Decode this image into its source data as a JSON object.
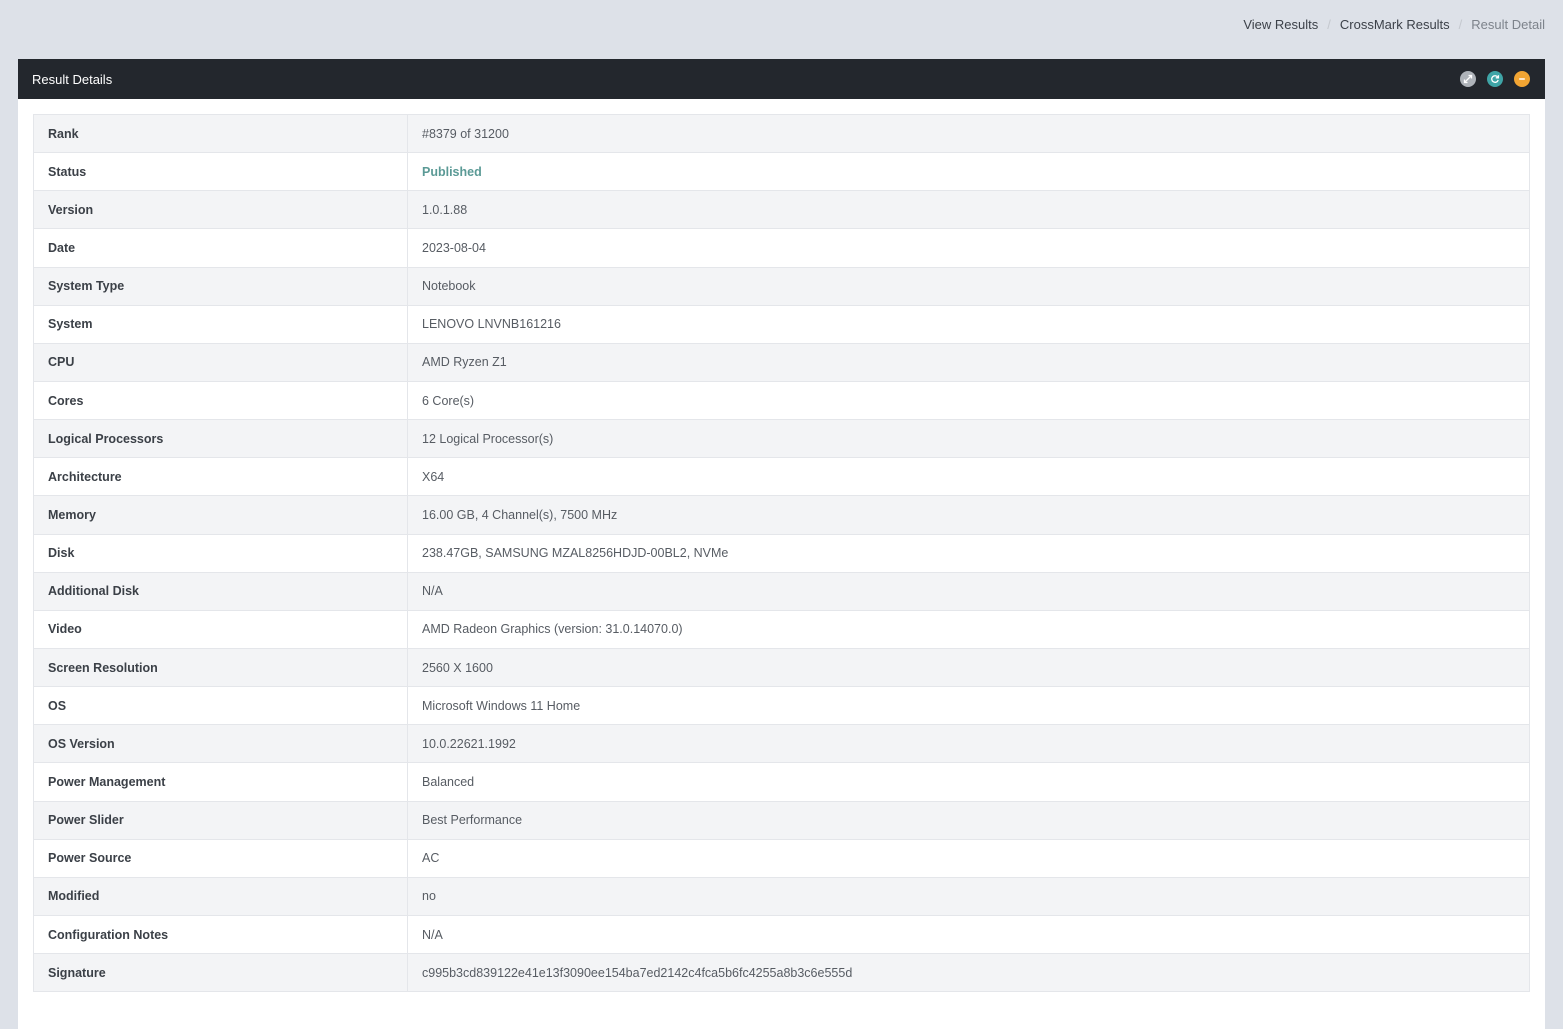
{
  "breadcrumb": {
    "items": [
      "View Results",
      "CrossMark Results"
    ],
    "current": "Result Detail"
  },
  "panel": {
    "title": "Result Details",
    "tools": [
      "expand-icon",
      "refresh-icon",
      "collapse-icon"
    ],
    "tool_colors": {
      "expand": "#aeb3b9",
      "refresh": "#3fa5a7",
      "collapse": "#f2a533"
    }
  },
  "details": {
    "rows": [
      {
        "label": "Rank",
        "value": "#8379 of 31200"
      },
      {
        "label": "Status",
        "value": "Published"
      },
      {
        "label": "Version",
        "value": "1.0.1.88"
      },
      {
        "label": "Date",
        "value": "2023-08-04"
      },
      {
        "label": "System Type",
        "value": "Notebook"
      },
      {
        "label": "System",
        "value": "LENOVO LNVNB161216"
      },
      {
        "label": "CPU",
        "value": "AMD Ryzen Z1"
      },
      {
        "label": "Cores",
        "value": "6 Core(s)"
      },
      {
        "label": "Logical Processors",
        "value": "12 Logical Processor(s)"
      },
      {
        "label": "Architecture",
        "value": "X64"
      },
      {
        "label": "Memory",
        "value": "16.00 GB, 4 Channel(s), 7500 MHz"
      },
      {
        "label": "Disk",
        "value": "238.47GB, SAMSUNG MZAL8256HDJD-00BL2, NVMe"
      },
      {
        "label": "Additional Disk",
        "value": "N/A"
      },
      {
        "label": "Video",
        "value": "AMD Radeon Graphics (version: 31.0.14070.0)"
      },
      {
        "label": "Screen Resolution",
        "value": "2560 X 1600"
      },
      {
        "label": "OS",
        "value": "Microsoft Windows 11 Home"
      },
      {
        "label": "OS Version",
        "value": "10.0.22621.1992"
      },
      {
        "label": "Power Management",
        "value": "Balanced"
      },
      {
        "label": "Power Slider",
        "value": "Best Performance"
      },
      {
        "label": "Power Source",
        "value": "AC"
      },
      {
        "label": "Modified",
        "value": "no"
      },
      {
        "label": "Configuration Notes",
        "value": "N/A"
      },
      {
        "label": "Signature",
        "value": "c995b3cd839122e41e13f3090ee154ba7ed2142c4fca5b6fc4255a8b3c6e555d"
      }
    ]
  },
  "colors": {
    "page_background": "#dde1e8",
    "header_background": "#23272d",
    "status_published": "#5b9a96"
  }
}
